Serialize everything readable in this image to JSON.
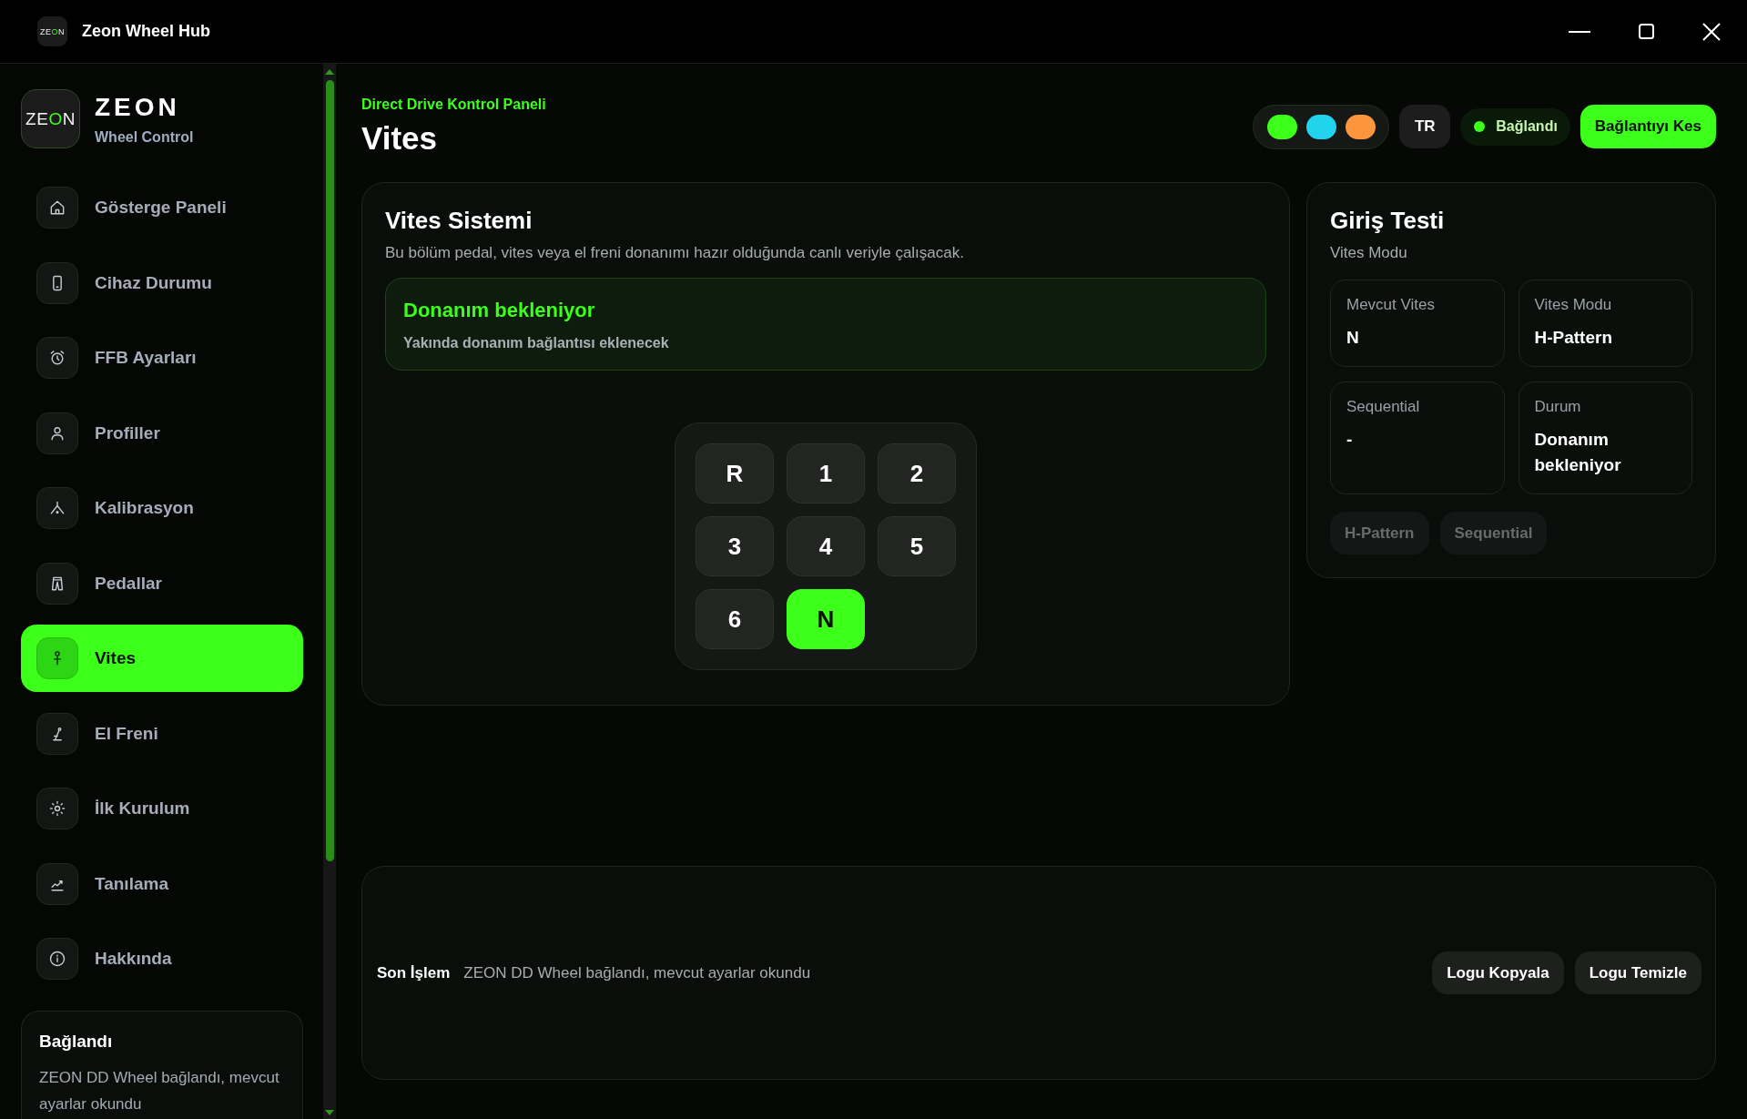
{
  "titlebar": {
    "logo": {
      "parts": [
        {
          "text": "ZE",
          "accent": false
        },
        {
          "text": "O",
          "accent": true
        },
        {
          "text": "N",
          "accent": false
        }
      ]
    },
    "title": "Zeon Wheel Hub"
  },
  "sidebar": {
    "brand": {
      "logo": {
        "parts": [
          {
            "text": "ZE",
            "accent": false
          },
          {
            "text": "O",
            "accent": true
          },
          {
            "text": "N",
            "accent": false
          }
        ]
      },
      "name": "ZEON",
      "tagline": "Wheel Control"
    },
    "items": [
      {
        "label": "Gösterge Paneli",
        "selected": false
      },
      {
        "label": "Cihaz Durumu",
        "selected": false
      },
      {
        "label": "FFB Ayarları",
        "selected": false
      },
      {
        "label": "Profiller",
        "selected": false
      },
      {
        "label": "Kalibrasyon",
        "selected": false
      },
      {
        "label": "Pedallar",
        "selected": false
      },
      {
        "label": "Vites",
        "selected": true
      },
      {
        "label": "El Freni",
        "selected": false
      },
      {
        "label": "İlk Kurulum",
        "selected": false
      },
      {
        "label": "Tanılama",
        "selected": false
      },
      {
        "label": "Hakkında",
        "selected": false
      }
    ],
    "status_card": {
      "title": "Bağlandı",
      "text": "ZEON DD Wheel bağlandı, mevcut ayarlar okundu"
    }
  },
  "header": {
    "eyebrow": "Direct Drive Kontrol Paneli",
    "title": "Vites",
    "themes": [
      {
        "color": "#3cff1a"
      },
      {
        "color": "#22d3ee"
      },
      {
        "color": "#fb963f"
      }
    ],
    "language": "TR",
    "connection": {
      "label": "Bağlandı"
    },
    "disconnect_button": "Bağlantıyı Kes"
  },
  "gear_card": {
    "title": "Vites Sistemi",
    "description": "Bu bölüm pedal, vites veya el freni donanımı hazır olduğunda canlı veriyle çalışacak.",
    "notice": {
      "title": "Donanım bekleniyor",
      "text": "Yakında donanım bağlantısı eklenecek"
    },
    "gears": [
      {
        "label": "R",
        "selected": false
      },
      {
        "label": "1",
        "selected": false
      },
      {
        "label": "2",
        "selected": false
      },
      {
        "label": "3",
        "selected": false
      },
      {
        "label": "4",
        "selected": false
      },
      {
        "label": "5",
        "selected": false
      },
      {
        "label": "6",
        "selected": false
      },
      {
        "label": "N",
        "selected": true
      }
    ]
  },
  "input_test": {
    "title": "Giriş Testi",
    "subtitle": "Vites Modu",
    "stats": [
      {
        "label": "Mevcut Vites",
        "value": "N"
      },
      {
        "label": "Vites Modu",
        "value": "H-Pattern"
      },
      {
        "label": "Sequential",
        "value": "-"
      },
      {
        "label": "Durum",
        "value": "Donanım bekleniyor"
      }
    ],
    "mode_buttons": [
      {
        "label": "H-Pattern",
        "disabled": true
      },
      {
        "label": "Sequential",
        "disabled": true
      }
    ]
  },
  "log": {
    "label": "Son İşlem",
    "text": "ZEON DD Wheel bağlandı, mevcut ayarlar okundu",
    "buttons": [
      "Logu Kopyala",
      "Logu Temizle"
    ]
  }
}
